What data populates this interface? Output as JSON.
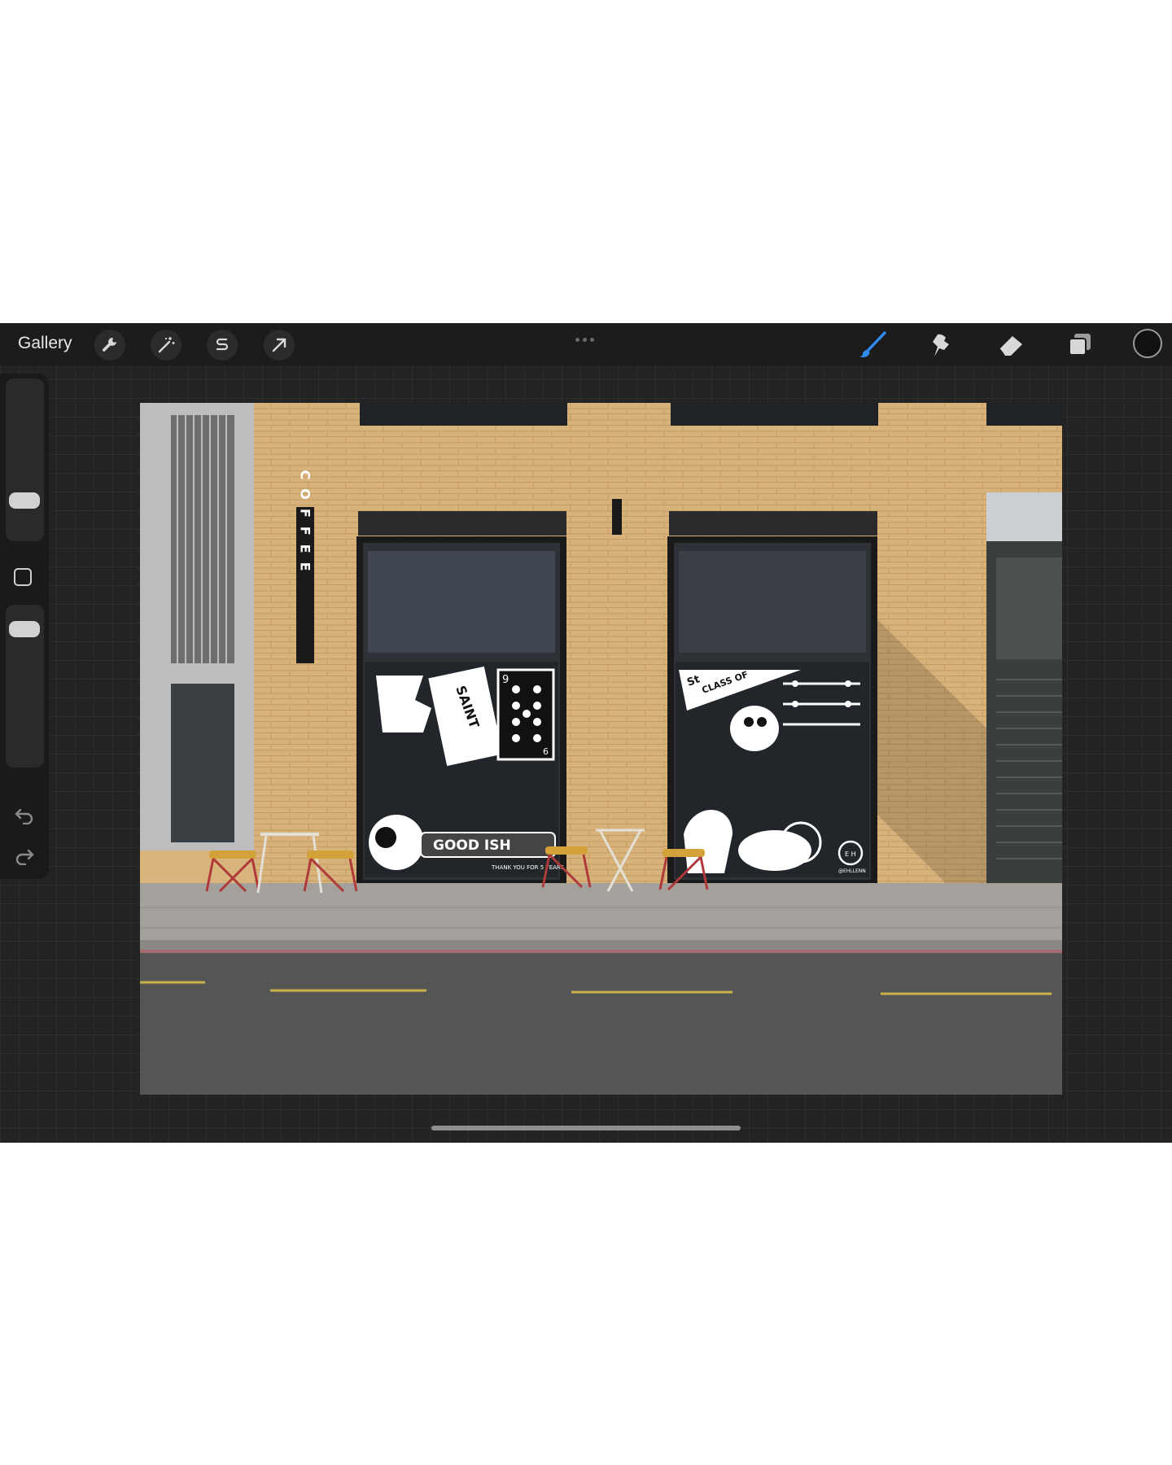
{
  "app": {
    "name": "Procreate",
    "gallery_label": "Gallery"
  },
  "toolbar_left": {
    "icons": [
      "wrench-icon",
      "magic-wand-icon",
      "selection-s-icon",
      "transform-arrow-icon"
    ]
  },
  "toolbar_right": {
    "icons": [
      "brush-icon",
      "smudge-icon",
      "eraser-icon",
      "layers-icon",
      "color-swatch-icon"
    ],
    "active_tool": "brush",
    "active_color": "#111111",
    "accent": "#2f8cf0"
  },
  "sidebar": {
    "controls": [
      "brush-size-slider",
      "modify-button",
      "opacity-slider",
      "undo-icon",
      "redo-icon"
    ]
  },
  "canvas": {
    "sign_text": "COFFEE",
    "window_left": {
      "card_rank": "9",
      "card_bottom_rank": "6",
      "banner_text": "SAINT",
      "footer_text": "GOOD ISH",
      "footer_small": "THANK YOU FOR 5 YEARS"
    },
    "window_right": {
      "pennant_text": "CLASS OF",
      "pennant_top": "St",
      "tag": "@EHLLENN",
      "logo_letters": "E H"
    }
  }
}
